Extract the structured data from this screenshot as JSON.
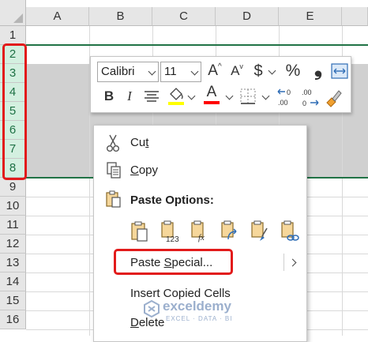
{
  "sheet": {
    "columns": [
      "A",
      "B",
      "C",
      "D",
      "E"
    ],
    "rows": [
      "1",
      "2",
      "3",
      "4",
      "5",
      "6",
      "7",
      "8",
      "9",
      "10",
      "11",
      "12",
      "13",
      "14",
      "15",
      "16"
    ],
    "selected_rows": [
      "2",
      "3",
      "4",
      "5",
      "6",
      "7",
      "8"
    ]
  },
  "mini_toolbar": {
    "font_name": "Calibri",
    "font_size": "11",
    "increase_font_glyph": "A",
    "decrease_font_glyph": "A",
    "currency_glyph": "$",
    "percent_glyph": "%",
    "comma_glyph": "❟",
    "bold": "B",
    "italic": "I",
    "font_color_glyph": "A",
    "increase_decimal": ".00",
    "decrease_decimal": ".00",
    "fill_color": "#FFFF00",
    "font_color": "#FF0000"
  },
  "context_menu": {
    "cut_prefix": "Cu",
    "cut_hotkey": "t",
    "copy_hotkey": "C",
    "copy_suffix": "opy",
    "paste_options_label": "Paste Options:",
    "paste_special_prefix": "Paste ",
    "paste_special_hotkey": "S",
    "paste_special_suffix": "pecial...",
    "insert_copied_label": "Insert Copied Cells",
    "delete_hotkey": "D",
    "delete_suffix": "elete",
    "paste_icon_labels": [
      "",
      "123",
      "fx",
      "",
      "",
      ""
    ]
  },
  "watermark": {
    "name": "exceldemy",
    "tagline": "EXCEL · DATA · BI"
  },
  "colors": {
    "highlight": "#E21B1B",
    "selection_border": "#217346",
    "selected_header": "#D3F0E0"
  }
}
